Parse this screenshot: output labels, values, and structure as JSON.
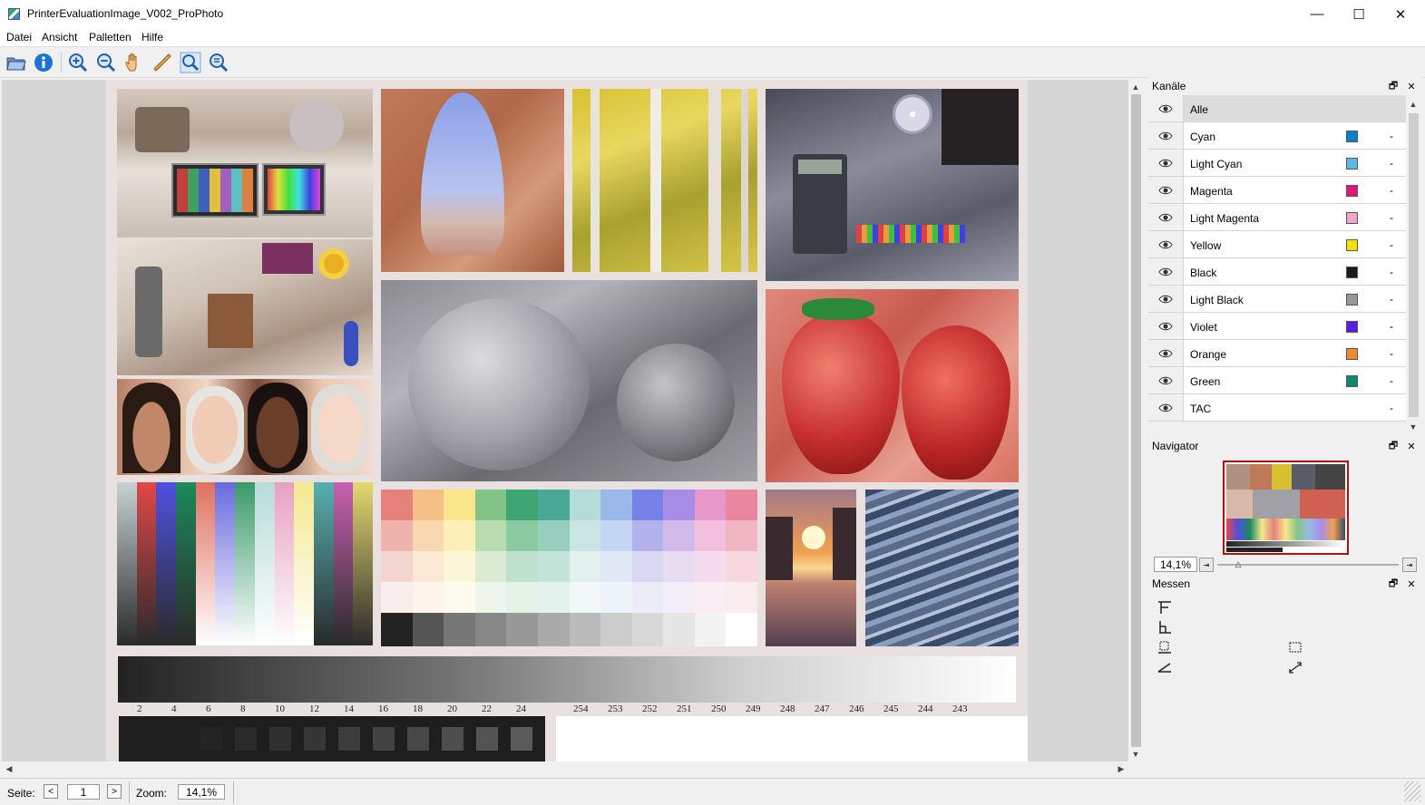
{
  "window": {
    "title": "PrinterEvaluationImage_V002_ProPhoto",
    "minimize_glyph": "—",
    "maximize_glyph": "☐",
    "close_glyph": "✕"
  },
  "menu": [
    "Datei",
    "Ansicht",
    "Palletten",
    "Hilfe"
  ],
  "toolbar": {
    "icons": [
      "open-folder-icon",
      "info-icon",
      "zoom-in-icon",
      "zoom-out-icon",
      "hand-pan-icon",
      "ruler-icon",
      "zoom-fit-icon",
      "zoom-actual-icon"
    ]
  },
  "image": {
    "step_labels_left": [
      "2",
      "4",
      "6",
      "8",
      "10",
      "12",
      "14",
      "16",
      "18",
      "20",
      "22",
      "24"
    ],
    "step_labels_right": [
      "254",
      "253",
      "252",
      "251",
      "250",
      "249",
      "248",
      "247",
      "246",
      "245",
      "244",
      "243"
    ],
    "gamut_colors": {
      "row1": [
        "#e6827a",
        "#f5bf88",
        "#f9e58a",
        "#82c386",
        "#3ea575",
        "#4aa896",
        "#b4dcd8",
        "#9ab8e8",
        "#7782e6",
        "#a88ce8",
        "#e696c8",
        "#e8879e"
      ],
      "row2": [
        "#eeb4ac",
        "#f8d8b0",
        "#faf0b8",
        "#b9dcb0",
        "#8ccaa4",
        "#98cebd",
        "#cae6e4",
        "#c4d6f2",
        "#b2b2ec",
        "#d2baea",
        "#f1c0de",
        "#f0b6c4"
      ],
      "row3": [
        "#f4d6d0",
        "#fbe9d4",
        "#fcf6d8",
        "#dcecd4",
        "#c0e2cc",
        "#c4e4da",
        "#e2f0ee",
        "#e0e8f6",
        "#d8d8f2",
        "#e8dcf2",
        "#f6dcec",
        "#f6d8de"
      ],
      "row4": [
        "#faeeec",
        "#fdf5ec",
        "#fdfbee",
        "#eef6ec",
        "#e4f2e8",
        "#e4f2ee",
        "#f1f8f7",
        "#eff3fa",
        "#ececf8",
        "#f3eef8",
        "#faeef5",
        "#faecee"
      ],
      "gray": [
        "#222222",
        "#555555",
        "#777777",
        "#888888",
        "#999999",
        "#aaaaaa",
        "#bbbbbb",
        "#cccccc",
        "#d8d8d8",
        "#e6e6e6",
        "#f3f3f3",
        "#ffffff"
      ]
    },
    "vertical_ramps": [
      "#c6d2d4",
      "#e04848",
      "#5050e0",
      "#1a8a5a",
      "#e07060",
      "#6a6ae0",
      "#3a9a68",
      "#b8dcd8",
      "#e8a0c0",
      "#f4e890",
      "#58b0b0",
      "#c860b0",
      "#e4d870"
    ]
  },
  "statusbar": {
    "page_label": "Seite:",
    "prev": "<",
    "page_value": "1",
    "next": ">",
    "zoom_label": "Zoom:",
    "zoom_value": "14,1%"
  },
  "channels_panel": {
    "title": "Kanäle",
    "float_glyph": "🗗",
    "close_glyph": "✕",
    "rows": [
      {
        "name": "Alle",
        "color": null,
        "dash": ""
      },
      {
        "name": "Cyan",
        "color": "#0a7fd0",
        "dash": "-"
      },
      {
        "name": "Light Cyan",
        "color": "#5cb8e4",
        "dash": "-"
      },
      {
        "name": "Magenta",
        "color": "#e0187a",
        "dash": "-"
      },
      {
        "name": "Light Magenta",
        "color": "#f0a4c8",
        "dash": "-"
      },
      {
        "name": "Yellow",
        "color": "#f4e000",
        "dash": "-"
      },
      {
        "name": "Black",
        "color": "#1a1a1a",
        "dash": "-"
      },
      {
        "name": "Light Black",
        "color": "#999999",
        "dash": "-"
      },
      {
        "name": "Violet",
        "color": "#5a1ae8",
        "dash": "-"
      },
      {
        "name": "Orange",
        "color": "#f08a30",
        "dash": "-"
      },
      {
        "name": "Green",
        "color": "#0a8a6a",
        "dash": "-"
      },
      {
        "name": "TAC",
        "color": null,
        "dash": "-"
      }
    ]
  },
  "navigator_panel": {
    "title": "Navigator",
    "float_glyph": "🗗",
    "close_glyph": "✕",
    "zoom_value": "14,1%",
    "zoom_progress": 0.1
  },
  "measure_panel": {
    "title": "Messen",
    "float_glyph": "🗗",
    "close_glyph": "✕",
    "tools": [
      "measure-top-icon",
      "measure-left-icon",
      "measure-bottom-icon",
      "measure-angle-icon",
      "measure-rect-icon",
      "measure-distance-icon"
    ]
  }
}
